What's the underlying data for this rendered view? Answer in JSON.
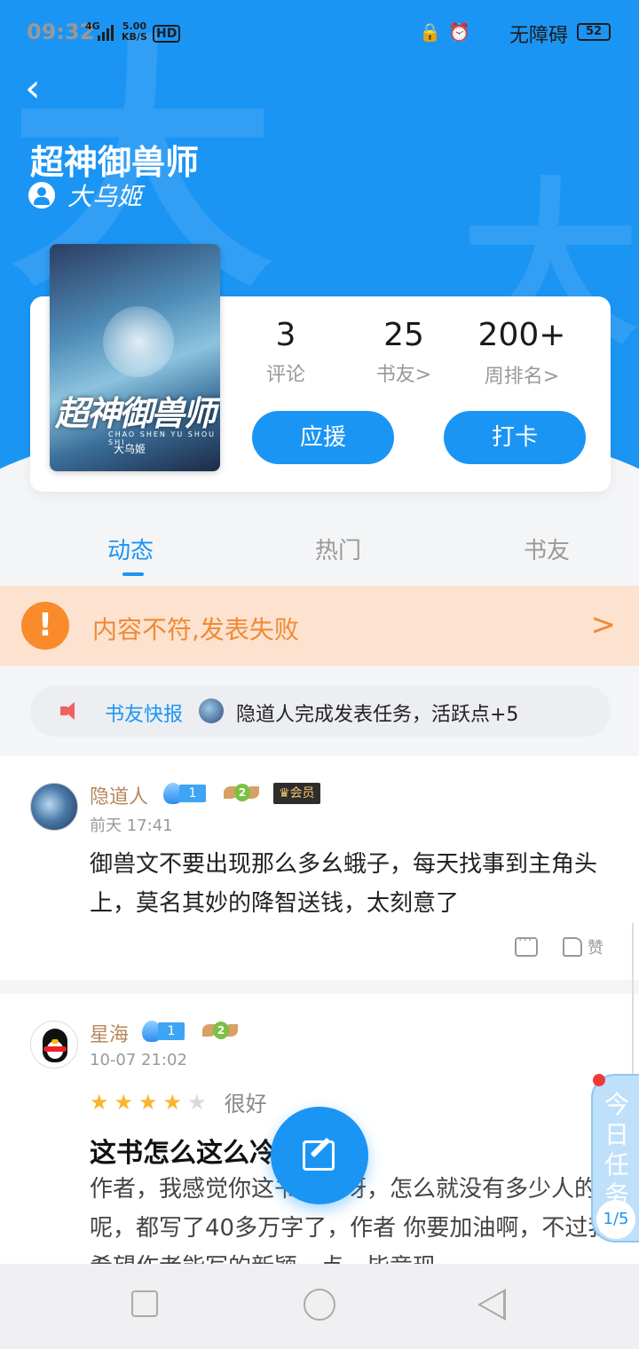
{
  "status_bar": {
    "time": "09:32",
    "network": "4G",
    "speed_value": "5.00",
    "speed_unit": "KB/S",
    "hd": "HD",
    "accessibility": "无障碍",
    "battery": "52"
  },
  "book": {
    "title": "超神御兽师",
    "author": "大乌姬",
    "cover_title": "超神御兽师",
    "cover_pinyin": "CHAO SHEN YU SHOU SHI",
    "cover_author": "大乌姬"
  },
  "stats": [
    {
      "value": "3",
      "label": "评论"
    },
    {
      "value": "25",
      "label": "书友>"
    },
    {
      "value": "200+",
      "label": "周排名>"
    }
  ],
  "actions": {
    "support": "应援",
    "checkin": "打卡"
  },
  "tabs": [
    {
      "label": "动态",
      "active": true
    },
    {
      "label": "热门",
      "active": false
    },
    {
      "label": "书友",
      "active": false
    }
  ],
  "banner": {
    "message": "内容不符,发表失败",
    "arrow": ">"
  },
  "ticker": {
    "label": "书友快报",
    "text": "隐道人完成发表任务，活跃点+5"
  },
  "posts": [
    {
      "user": "隐道人",
      "level": "1",
      "badge": "2",
      "vip": "会员",
      "time": "前天 17:41",
      "content": "御兽文不要出现那么多幺蛾子，每天找事到主角头上，莫名其妙的降智送钱，太刻意了",
      "like_label": "赞"
    },
    {
      "user": "星海",
      "level": "1",
      "badge": "2",
      "time": "10-07 21:02",
      "rating": 4,
      "rating_text": "很好",
      "title": "这书怎么这么冷",
      "content": "作者，我感觉你这书可以呀，怎么就没有多少人的呢，都写了40多万字了，作者 你要加油啊，不过我希望作者能写的新颖一点，毕竟现"
    }
  ],
  "daily_task": {
    "label": "今日任务",
    "progress": "1/5"
  },
  "colors": {
    "primary": "#1b95f4",
    "banner_bg": "#fde2cf",
    "banner_text": "#f08a34",
    "username": "#b8875a"
  }
}
